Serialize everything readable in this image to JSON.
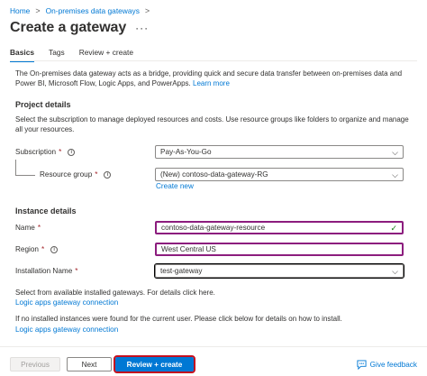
{
  "breadcrumb": {
    "items": [
      "Home",
      "On-premises data gateways"
    ],
    "separator": ">"
  },
  "header": {
    "title": "Create a gateway",
    "more": "···"
  },
  "tabs": [
    {
      "label": "Basics",
      "active": true
    },
    {
      "label": "Tags",
      "active": false
    },
    {
      "label": "Review + create",
      "active": false
    }
  ],
  "intro": {
    "text": "The On-premises data gateway acts as a bridge, providing quick and secure data transfer between on-premises data and Power BI, Microsoft Flow, Logic Apps, and PowerApps.",
    "link": "Learn more"
  },
  "project": {
    "title": "Project details",
    "description": "Select the subscription to manage deployed resources and costs. Use resource groups like folders to organize and manage all your resources.",
    "subscription": {
      "label": "Subscription",
      "value": "Pay-As-You-Go"
    },
    "resource_group": {
      "label": "Resource group",
      "value": "(New) contoso-data-gateway-RG",
      "create_new": "Create new"
    }
  },
  "instance": {
    "title": "Instance details",
    "name": {
      "label": "Name",
      "value": "contoso-data-gateway-resource"
    },
    "region": {
      "label": "Region",
      "value": "West Central US"
    },
    "installation": {
      "label": "Installation Name",
      "value": "test-gateway"
    },
    "note1": "Select from available installed gateways. For details click here.",
    "link1": "Logic apps gateway connection",
    "note2": "If no installed instances were found for the current user. Please click below for details on how to install.",
    "link2": "Logic apps gateway connection"
  },
  "footer": {
    "previous": "Previous",
    "next": "Next",
    "review_create": "Review + create",
    "feedback": "Give feedback"
  },
  "symbols": {
    "required": "*",
    "info": "i",
    "chevron": "⌵",
    "check": "✓"
  },
  "colors": {
    "accent": "#0078d4",
    "required": "#a4262c",
    "highlight": "#8c1d7e",
    "review_outline": "#c50f1f",
    "valid": "#107c10"
  }
}
